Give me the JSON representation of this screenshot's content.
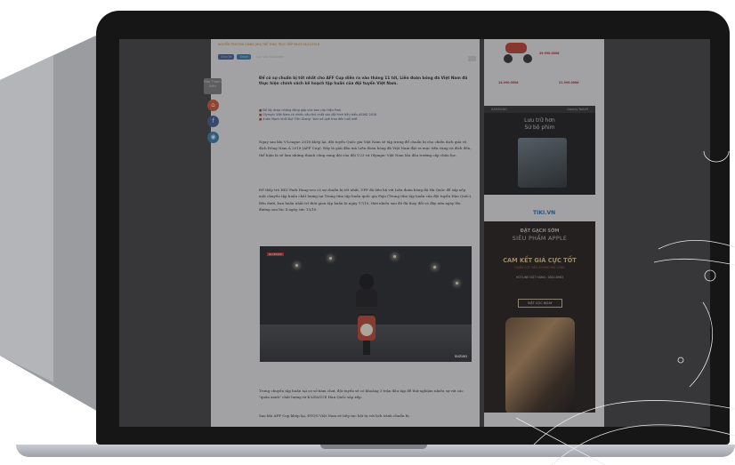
{
  "article": {
    "meta": "NGUYỄN TRƯỜNG GIANG (HN)  THỂ THAO TRỰC TIẾP  08:05 04/12/2018",
    "share": {
      "facebook": "Chia sẻ",
      "twitter": "Tweet",
      "other": "Lưu vào Facebook"
    },
    "sidebar_logo": "Báo Thanh Niên",
    "lead": "Để có sự chuẩn bị tốt nhất cho AFF Cup diễn ra vào tháng 11 tới, Liên đoàn bóng đá Việt Nam đã thực hiện chính sách kế hoạch tập huấn của đội tuyển Việt Nam.",
    "related": [
      "Để lấy được những đóng góp của ban của Hiệu Park",
      "Olympic Việt Nam có nhiều cầu thủ nhất vào đội hình tiêu biểu ASIAD 2018",
      "Xuân Mạnh khối Bụt Tiền Giang: 'Anh sẽ quê trao đến tuổi mới'"
    ],
    "para1": "Ngay sau khi V-League 2018 khép lại, đội tuyển Quốc gia Việt Nam sẽ tập trung để chuẩn bị cho chiến dịch giải vô địch Đông Nam Á 2018 (AFF Cup). Đây là giải đấu mà Liên đoàn bóng đá Việt Nam đặt ra mục tiêu vàng và đích đến, thể hiện là sẽ làm những thành công vang dội của đội U23 và Olympic Việt Nam lần đầu trường cấp châu lục.",
    "para2": "Để thầy trò HLV Park Hang-seo có sự chuẩn bị tốt nhất, VFF đã liên hệ với Liên đoàn bóng đá Hà Quốc để sắp xếp một chuyến tập huấn chất lượng tại Trung tâm tập huấn quốc gia Paju (Trung tâm tập huấn của đội tuyển Hàn Quốc). Bên dưới, ban huấn nhất trí thời gian tập huấn là ngày 17/10, thời nhiều sau đó đã thay đổi và đây nữa ngày lên đường sau lúc 4 ngày, tức 15/10.",
    "para3": "Trong chuyến tập huấn tại cơ sở hàm chơi, đội tuyển sẽ có khoảng 3 trận đấu tập để thử nghiệm nhiều sự với các \"quân xanh\" chất lượng từ K-LEAGUE Hàn Quốc sắp xếp.",
    "para4": "Sau khi AFF Cup khép lại, ĐTQG Việt Nam sẽ tiếp tục hội tụ với lịch trình chuẩn bị",
    "photo_badge": "BLUERIDE",
    "photo_stamp": "SUZUKI"
  },
  "ads": {
    "top_prices": [
      "29.990.000đ",
      "14.990.000đ",
      "21.990.000đ"
    ],
    "samsung": {
      "brand": "SAMSUNG",
      "model": "Galaxy Note9",
      "headline": "Lưu trữ hơn\nSử bộ phim"
    },
    "tiki": "TIKI.VN",
    "apple": {
      "line1": "ĐẶT GẠCH SỚM",
      "line2": "SIÊU PHẨM APPLE",
      "line3": "CAM KẾT GIÁ CỰC TỐT",
      "line4": "HOÀN CỌC NẾU KHÔNG HÀI LÒNG",
      "line5": "HOTLINE ĐẶT HÀNG: 1800.6963",
      "button": "ĐẶT CỌC NGAY"
    }
  },
  "colors": {
    "accent_orange": "#c9781c",
    "facebook": "#3c5a94",
    "twitter": "#2e7db0",
    "laptop": "#161616"
  }
}
